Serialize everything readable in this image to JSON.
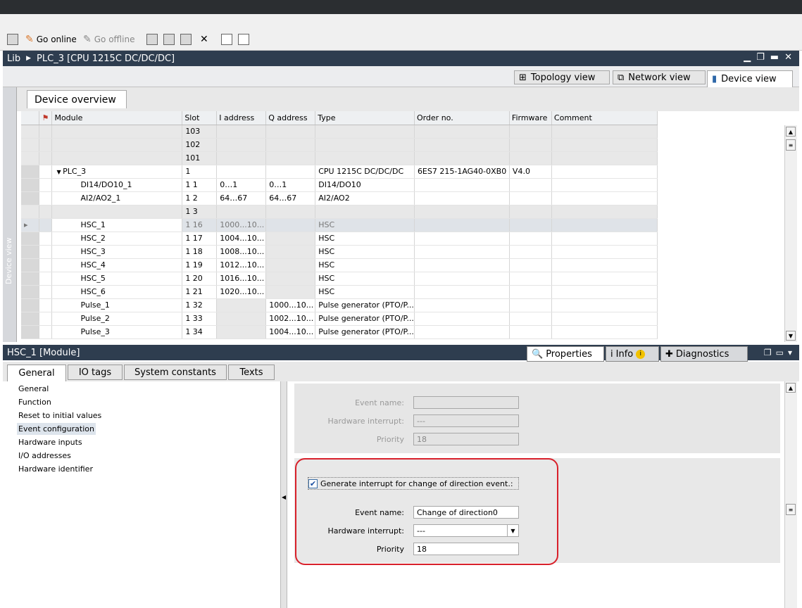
{
  "toolbar": {
    "go_online": "Go online",
    "go_offline": "Go offline"
  },
  "window": {
    "lib": "Lib",
    "breadcrumb": "PLC_3 [CPU 1215C DC/DC/DC]"
  },
  "view_tabs": [
    "Topology view",
    "Network view",
    "Device view"
  ],
  "device_view_label": "Device view",
  "overview_tab": "Device overview",
  "table": {
    "headers": [
      "Module",
      "Slot",
      "I address",
      "Q address",
      "Type",
      "Order no.",
      "Firmware",
      "Comment"
    ],
    "rows": [
      {
        "module": "",
        "slot": "103",
        "i": "",
        "q": "",
        "type": "",
        "order": "",
        "fw": "",
        "comment": ""
      },
      {
        "module": "",
        "slot": "102",
        "i": "",
        "q": "",
        "type": "",
        "order": "",
        "fw": "",
        "comment": ""
      },
      {
        "module": "",
        "slot": "101",
        "i": "",
        "q": "",
        "type": "",
        "order": "",
        "fw": "",
        "comment": ""
      },
      {
        "module": "PLC_3",
        "slot": "1",
        "i": "",
        "q": "",
        "type": "CPU 1215C DC/DC/DC",
        "order": "6ES7 215-1AG40-0XB0",
        "fw": "V4.0",
        "comment": ""
      },
      {
        "module": "DI14/DO10_1",
        "slot": "1 1",
        "i": "0…1",
        "q": "0…1",
        "type": "DI14/DO10",
        "order": "",
        "fw": "",
        "comment": ""
      },
      {
        "module": "AI2/AO2_1",
        "slot": "1 2",
        "i": "64…67",
        "q": "64…67",
        "type": "AI2/AO2",
        "order": "",
        "fw": "",
        "comment": ""
      },
      {
        "module": "",
        "slot": "1 3",
        "i": "",
        "q": "",
        "type": "",
        "order": "",
        "fw": "",
        "comment": ""
      },
      {
        "module": "HSC_1",
        "slot": "1 16",
        "i": "1000...10...",
        "q": "",
        "type": "HSC",
        "order": "",
        "fw": "",
        "comment": ""
      },
      {
        "module": "HSC_2",
        "slot": "1 17",
        "i": "1004...10...",
        "q": "",
        "type": "HSC",
        "order": "",
        "fw": "",
        "comment": ""
      },
      {
        "module": "HSC_3",
        "slot": "1 18",
        "i": "1008...10...",
        "q": "",
        "type": "HSC",
        "order": "",
        "fw": "",
        "comment": ""
      },
      {
        "module": "HSC_4",
        "slot": "1 19",
        "i": "1012...10...",
        "q": "",
        "type": "HSC",
        "order": "",
        "fw": "",
        "comment": ""
      },
      {
        "module": "HSC_5",
        "slot": "1 20",
        "i": "1016...10...",
        "q": "",
        "type": "HSC",
        "order": "",
        "fw": "",
        "comment": ""
      },
      {
        "module": "HSC_6",
        "slot": "1 21",
        "i": "1020...10...",
        "q": "",
        "type": "HSC",
        "order": "",
        "fw": "",
        "comment": ""
      },
      {
        "module": "Pulse_1",
        "slot": "1 32",
        "i": "",
        "q": "1000...10...",
        "type": "Pulse generator (PTO/P...",
        "order": "",
        "fw": "",
        "comment": ""
      },
      {
        "module": "Pulse_2",
        "slot": "1 33",
        "i": "",
        "q": "1002...10...",
        "type": "Pulse generator (PTO/P...",
        "order": "",
        "fw": "",
        "comment": ""
      },
      {
        "module": "Pulse_3",
        "slot": "1 34",
        "i": "",
        "q": "1004...10...",
        "type": "Pulse generator (PTO/P...",
        "order": "",
        "fw": "",
        "comment": ""
      }
    ]
  },
  "props": {
    "title": "HSC_1 [Module]",
    "tabs": [
      "Properties",
      "Info",
      "Diagnostics"
    ],
    "sub_tabs": [
      "General",
      "IO tags",
      "System constants",
      "Texts"
    ],
    "nav": [
      "General",
      "Function",
      "Reset to initial values",
      "Event configuration",
      "Hardware inputs",
      "I/O addresses",
      "Hardware identifier"
    ],
    "nav_active": "Event configuration",
    "sec1": {
      "event_name_label": "Event name:",
      "event_name_value": "",
      "hw_interrupt_label": "Hardware interrupt:",
      "hw_interrupt_value": "---",
      "priority_label": "Priority",
      "priority_value": "18"
    },
    "sec2": {
      "checkbox_label": "Generate interrupt for change of direction event.:",
      "checkbox_checked": true,
      "event_name_label": "Event name:",
      "event_name_value": "Change of direction0",
      "hw_interrupt_label": "Hardware interrupt:",
      "hw_interrupt_value": "---",
      "priority_label": "Priority",
      "priority_value": "18"
    }
  },
  "colors": {
    "title_bar": "#2e3d4f",
    "highlight": "#d8202a"
  }
}
